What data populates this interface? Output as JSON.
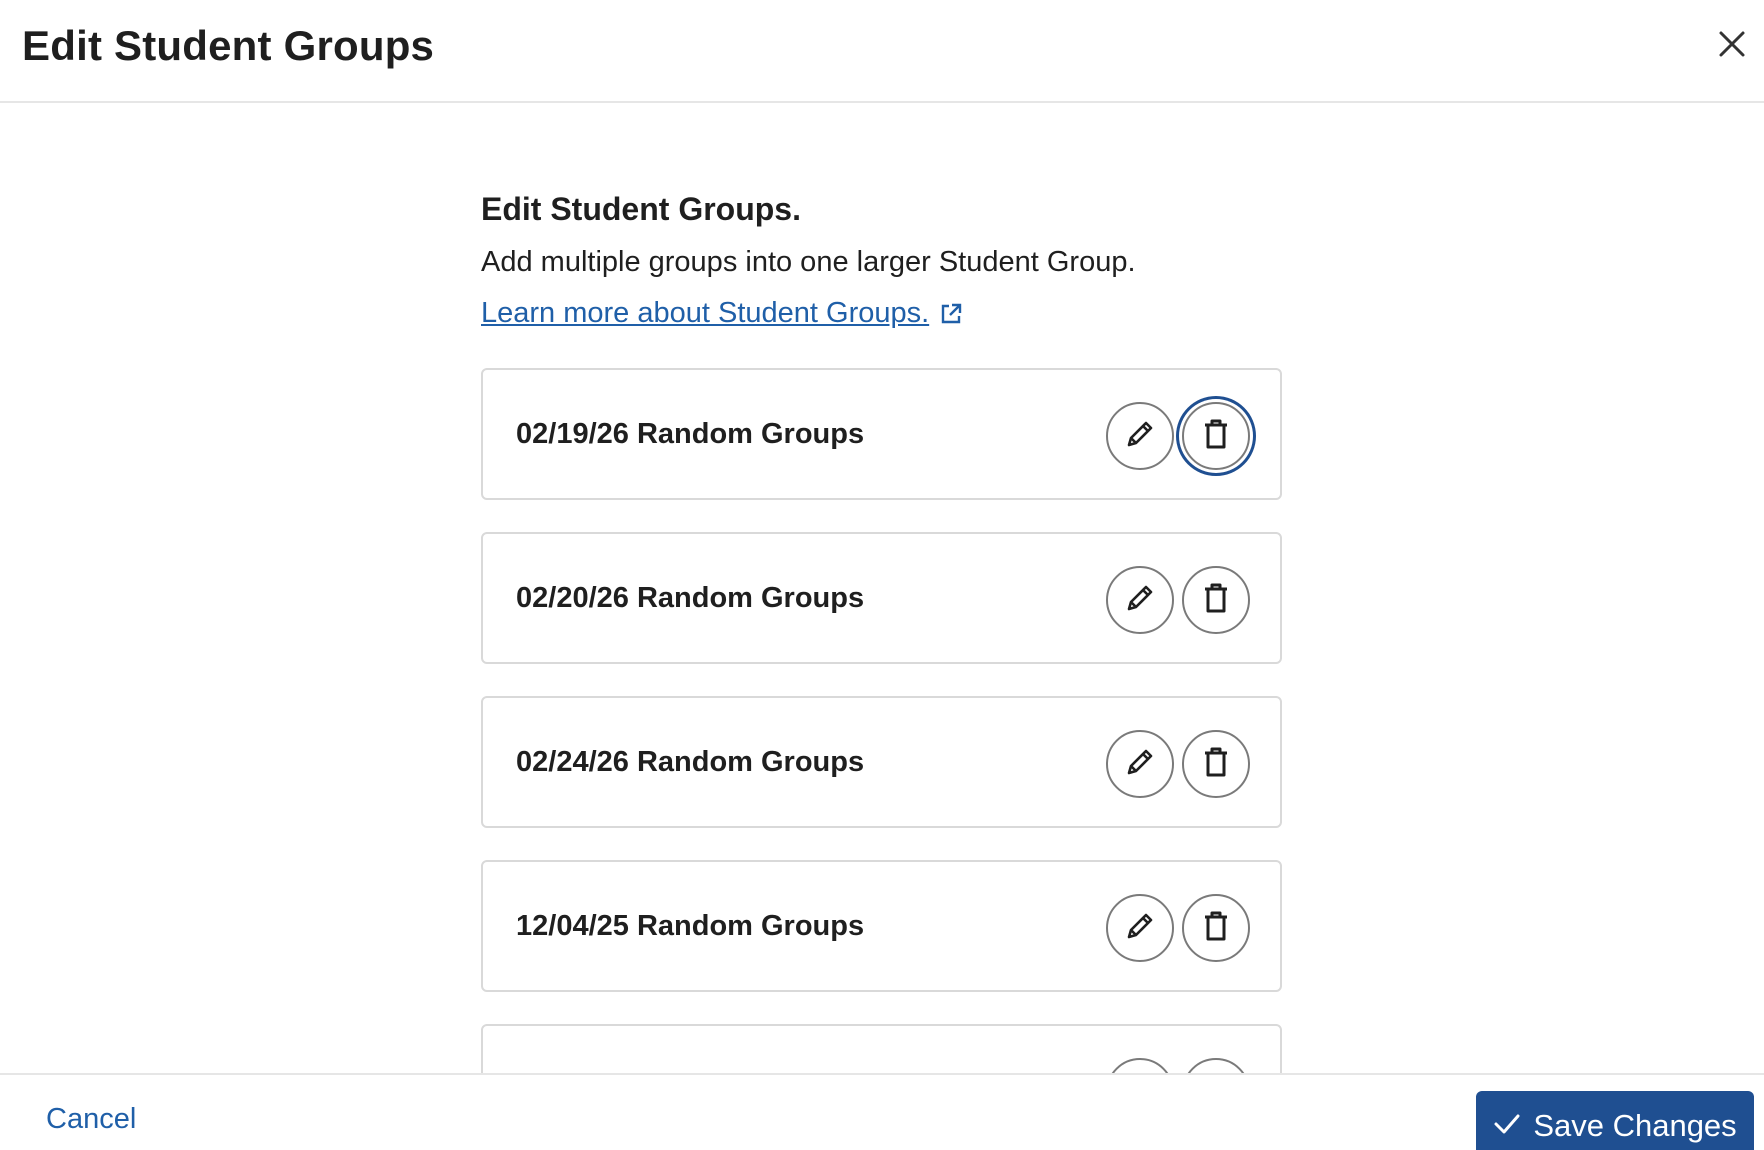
{
  "header": {
    "title": "Edit Student Groups",
    "close_icon": "close-icon"
  },
  "main": {
    "section_title": "Edit Student Groups.",
    "description": "Add multiple groups into one larger Student Group.",
    "learn_more_link": "Learn more about Student Groups.",
    "groups": [
      {
        "name": "02/19/26 Random Groups"
      },
      {
        "name": "02/20/26 Random Groups"
      },
      {
        "name": "02/24/26 Random Groups"
      },
      {
        "name": "12/04/25 Random Groups"
      },
      {
        "name": ""
      }
    ]
  },
  "footer": {
    "cancel_label": "Cancel",
    "save_label": "Save Changes"
  },
  "colors": {
    "accent": "#1f4f91",
    "link": "#1f5fa8",
    "border": "#d9d9d9"
  }
}
